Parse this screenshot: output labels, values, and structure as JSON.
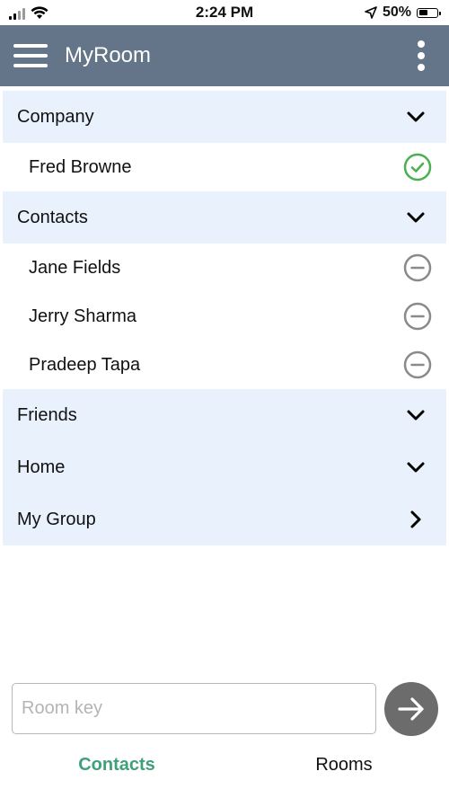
{
  "status_bar": {
    "time": "2:24 PM",
    "battery_percent": "50%",
    "battery_level": 0.5
  },
  "app_bar": {
    "title": "MyRoom",
    "menu_icon": "hamburger-menu-icon",
    "overflow_icon": "more-vertical-icon",
    "background_color": "#647589"
  },
  "groups": [
    {
      "label": "Company",
      "expanded": true,
      "contacts": [
        {
          "name": "Fred Browne",
          "status": "online"
        }
      ]
    },
    {
      "label": "Contacts",
      "expanded": true,
      "contacts": [
        {
          "name": "Jane Fields",
          "status": "offline"
        },
        {
          "name": "Jerry Sharma",
          "status": "offline"
        },
        {
          "name": "Pradeep Tapa",
          "status": "offline"
        }
      ]
    },
    {
      "label": "Friends",
      "expanded": true,
      "contacts": []
    },
    {
      "label": "Home",
      "expanded": true,
      "contacts": []
    },
    {
      "label": "My Group",
      "expanded": false,
      "contacts": []
    }
  ],
  "room_key": {
    "placeholder": "Room key",
    "value": ""
  },
  "tabs": [
    {
      "label": "Contacts",
      "active": true
    },
    {
      "label": "Rooms",
      "active": false
    }
  ],
  "colors": {
    "group_header_bg": "#e8f1fc",
    "online_green": "#4caf50",
    "offline_gray": "#8a8a8a",
    "active_tab": "#3fa07a",
    "go_button": "#6c6c6c"
  }
}
